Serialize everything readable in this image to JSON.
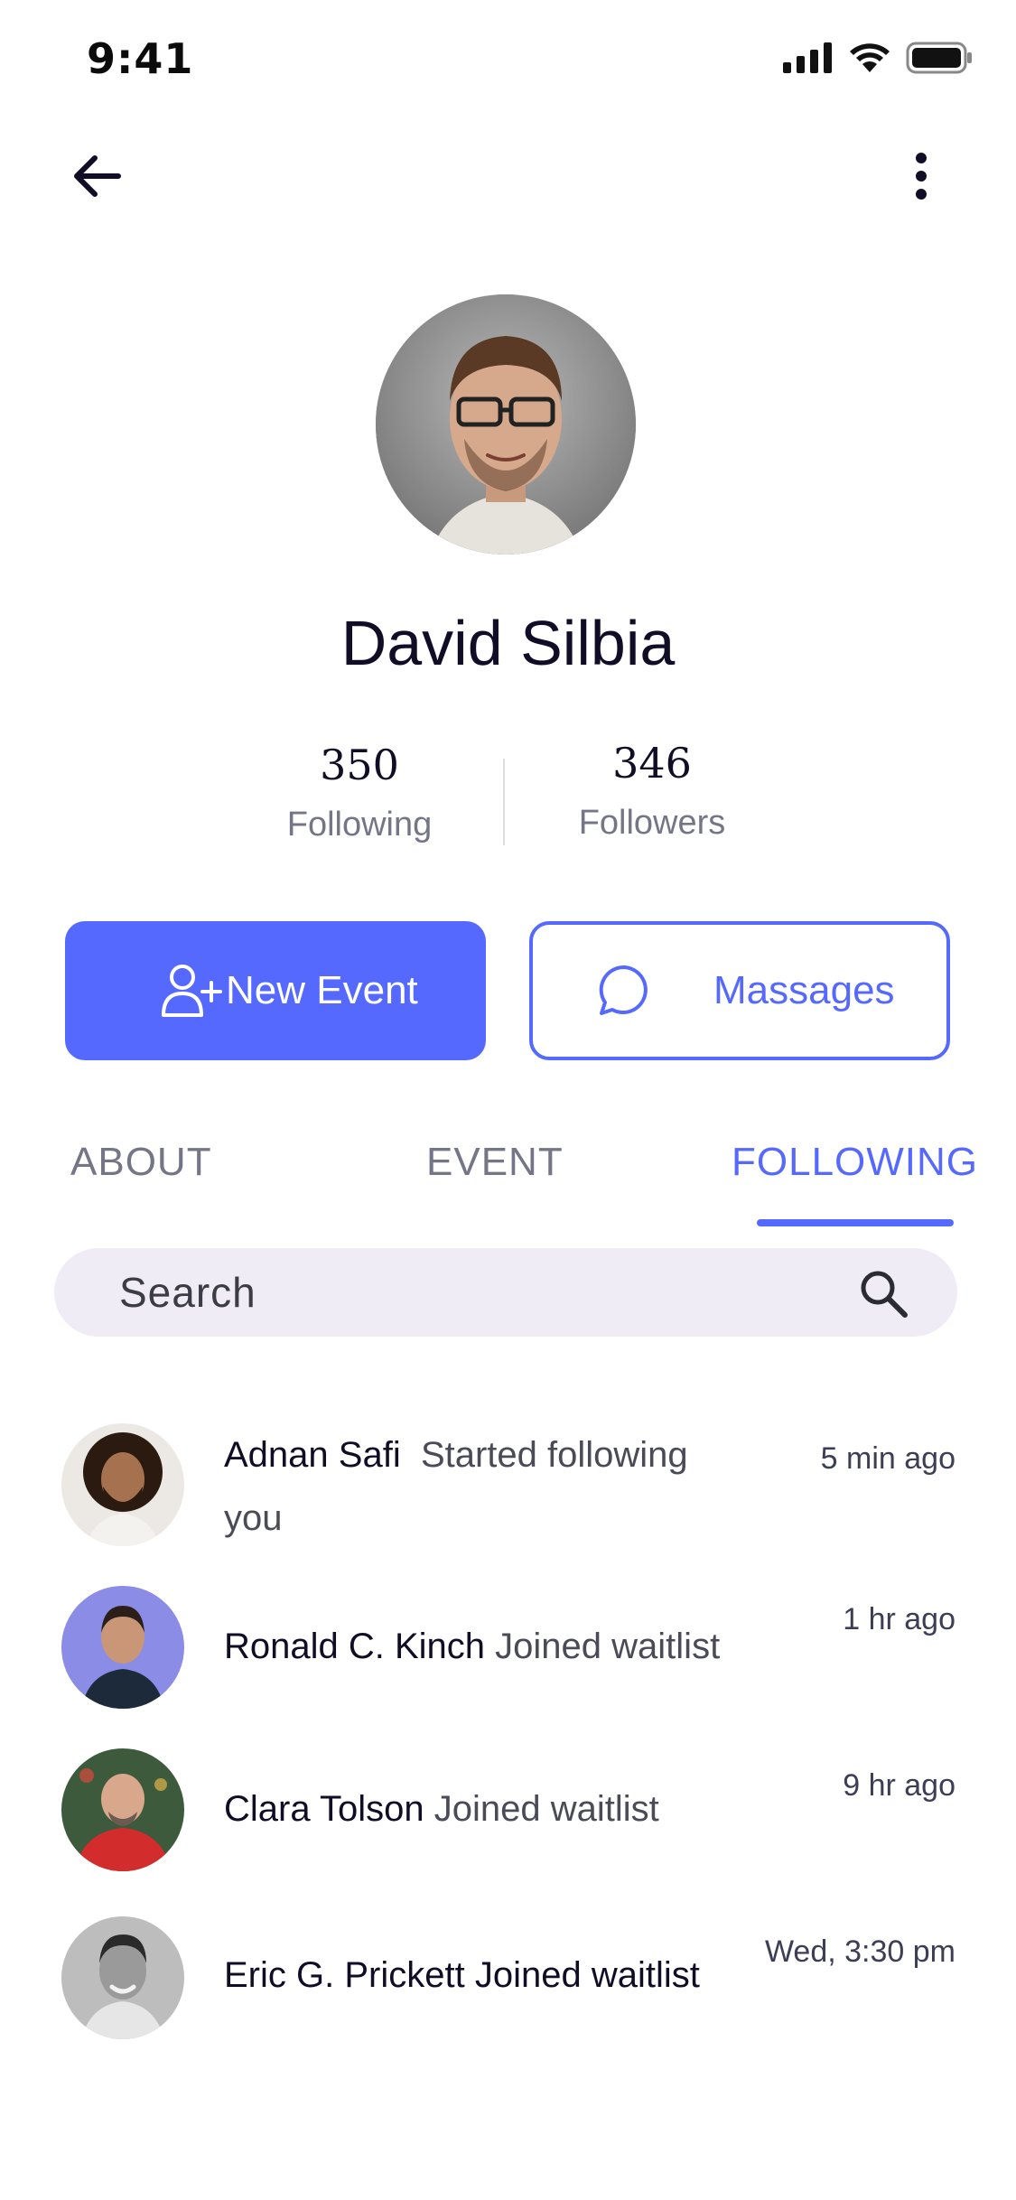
{
  "status_bar": {
    "time": "9:41"
  },
  "profile": {
    "name": "David  Silbia",
    "following_count": "350",
    "following_label": "Following",
    "followers_count": "346",
    "followers_label": "Followers"
  },
  "actions": {
    "new_event_label": "New Event",
    "messages_label": "Massages"
  },
  "tabs": [
    {
      "label": "ABOUT",
      "active": false
    },
    {
      "label": "EVENT",
      "active": false
    },
    {
      "label": "FOLLOWING",
      "active": true
    }
  ],
  "search": {
    "placeholder": "Search"
  },
  "activity": [
    {
      "name": "Adnan Safi",
      "action": "Started following you",
      "time": "5 min ago"
    },
    {
      "name": "Ronald C. Kinch",
      "action": "Joined waitlist",
      "time": "1 hr ago"
    },
    {
      "name": "Clara Tolson",
      "action": "Joined waitlist",
      "time": "9 hr ago"
    },
    {
      "name": "Eric G. Prickett",
      "action": "Joined waitlist",
      "time": "Wed, 3:30 pm"
    }
  ],
  "colors": {
    "accent": "#5669ff",
    "text_primary": "#120d26",
    "text_secondary": "#747688",
    "search_bg": "#f0ecf6"
  }
}
